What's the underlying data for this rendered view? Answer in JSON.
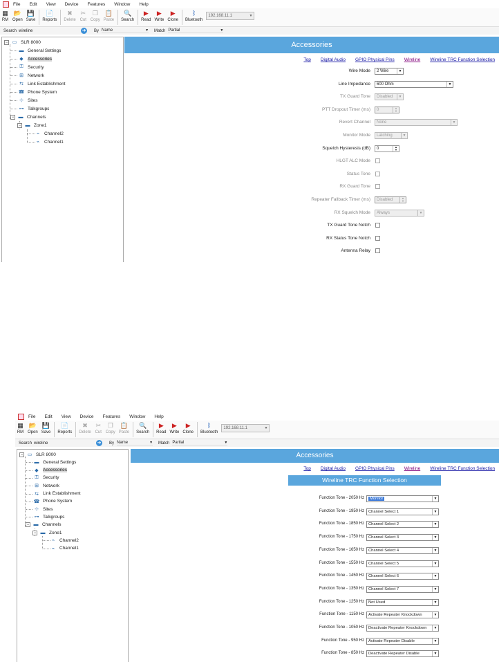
{
  "menu": [
    "File",
    "Edit",
    "View",
    "Device",
    "Features",
    "Window",
    "Help"
  ],
  "toolbar": {
    "buttons": [
      {
        "label": "RM",
        "icon": "rm-icon",
        "glyph": "▦",
        "enabled": true
      },
      {
        "label": "Open",
        "icon": "open-folder-icon",
        "glyph": "📂",
        "enabled": true
      },
      {
        "label": "Save",
        "icon": "save-disk-icon",
        "glyph": "💾",
        "enabled": true
      },
      {
        "label": "Reports",
        "icon": "report-icon",
        "glyph": "📄",
        "enabled": true
      },
      {
        "label": "Delete",
        "icon": "delete-x-icon",
        "glyph": "✖",
        "enabled": false
      },
      {
        "label": "Cut",
        "icon": "scissors-icon",
        "glyph": "✂",
        "enabled": false
      },
      {
        "label": "Copy",
        "icon": "copy-icon",
        "glyph": "❐",
        "enabled": false
      },
      {
        "label": "Paste",
        "icon": "paste-icon",
        "glyph": "📋",
        "enabled": false
      },
      {
        "label": "Search",
        "icon": "magnifier-icon",
        "glyph": "🔍",
        "enabled": true
      },
      {
        "label": "Read",
        "icon": "read-arrow-icon",
        "glyph": "▶",
        "enabled": true
      },
      {
        "label": "Write",
        "icon": "write-arrow-icon",
        "glyph": "▶",
        "enabled": true
      },
      {
        "label": "Clone",
        "icon": "clone-arrow-icon",
        "glyph": "▶",
        "enabled": true
      },
      {
        "label": "Bluetooth",
        "icon": "bluetooth-icon",
        "glyph": "ᛒ",
        "enabled": true
      }
    ],
    "ip_address": "192.168.11.1"
  },
  "search": {
    "label": "Search",
    "value": "wireline",
    "by_label": "By",
    "by_value": "Name",
    "match_label": "Match",
    "match_value": "Partial"
  },
  "tree": {
    "root": "SLR 8000",
    "items": [
      "General Settings",
      "Accessories",
      "Security",
      "Network",
      "Link Establishment",
      "Phone System",
      "Sites",
      "Talkgroups"
    ],
    "channels": "Channels",
    "zone": "Zone1",
    "zone_channels": [
      "Channel2",
      "Channel1"
    ],
    "selected": "Accessories"
  },
  "main": {
    "banner": "Accessories",
    "links": [
      "Top",
      "Digital Audio",
      "GPIO Physical Pins",
      "Wireline",
      "Wireline TRC Function Selection"
    ],
    "visited_link": "Wireline"
  },
  "accessories_fields": [
    {
      "label": "Wire Mode",
      "type": "select",
      "value": "2 Wire",
      "enabled": true
    },
    {
      "label": "Line Impedance",
      "type": "select",
      "value": "600 Ohm",
      "enabled": true
    },
    {
      "label": "TX Guard Tone",
      "type": "select",
      "value": "Disabled",
      "enabled": false
    },
    {
      "label": "PTT Dropout Timer (ms)",
      "type": "spin",
      "value": "0",
      "enabled": false
    },
    {
      "label": "Revert Channel",
      "type": "select",
      "value": "None",
      "enabled": false
    },
    {
      "label": "Monitor Mode",
      "type": "select",
      "value": "Latching",
      "enabled": false
    },
    {
      "label": "Squelch Hysteresis (dB)",
      "type": "spin",
      "value": "0",
      "enabled": true
    },
    {
      "label": "HLGT ALC Mode",
      "type": "check",
      "enabled": false
    },
    {
      "label": "Status Tone",
      "type": "check",
      "enabled": false
    },
    {
      "label": "RX Guard Tone",
      "type": "check",
      "enabled": false
    },
    {
      "label": "Repeater Fallback Timer (ms)",
      "type": "spin",
      "value": "Disabled",
      "enabled": false
    },
    {
      "label": "RX Squelch Mode",
      "type": "select",
      "value": "Always",
      "enabled": false
    },
    {
      "label": "TX Guard Tone Notch",
      "type": "check",
      "enabled": true
    },
    {
      "label": "RX Status Tone Notch",
      "type": "check",
      "enabled": true
    },
    {
      "label": "Antenna Relay",
      "type": "check",
      "enabled": true
    }
  ],
  "trc": {
    "section_title": "Wireline TRC Function Selection",
    "rows": [
      {
        "label": "Function Tone - 2050 Hz",
        "value": "Monitor"
      },
      {
        "label": "Function Tone - 1950 Hz",
        "value": "Channel Select 1"
      },
      {
        "label": "Function Tone - 1850 Hz",
        "value": "Channel Select 2"
      },
      {
        "label": "Function Tone - 1750 Hz",
        "value": "Channel Select 3"
      },
      {
        "label": "Function Tone - 1650 Hz",
        "value": "Channel Select 4"
      },
      {
        "label": "Function Tone - 1550 Hz",
        "value": "Channel Select 5"
      },
      {
        "label": "Function Tone - 1450 Hz",
        "value": "Channel Select 6"
      },
      {
        "label": "Function Tone - 1350 Hz",
        "value": "Channel Select 7"
      },
      {
        "label": "Function Tone - 1250 Hz",
        "value": "Not Used"
      },
      {
        "label": "Function Tone - 1150 Hz",
        "value": "Activate Repeater Knockdown"
      },
      {
        "label": "Function Tone - 1050 Hz",
        "value": "Deactivate Repeater Knockdown"
      },
      {
        "label": "Function Tone - 950 Hz",
        "value": "Activate Repeater Disable"
      },
      {
        "label": "Function Tone - 850 Hz",
        "value": "Deactivate Repeater Disable"
      }
    ]
  },
  "colors": {
    "banner": "#5aa6dd",
    "link": "#1a1aa6",
    "visited": "#80007a",
    "highlight": "#3d7ad8"
  }
}
